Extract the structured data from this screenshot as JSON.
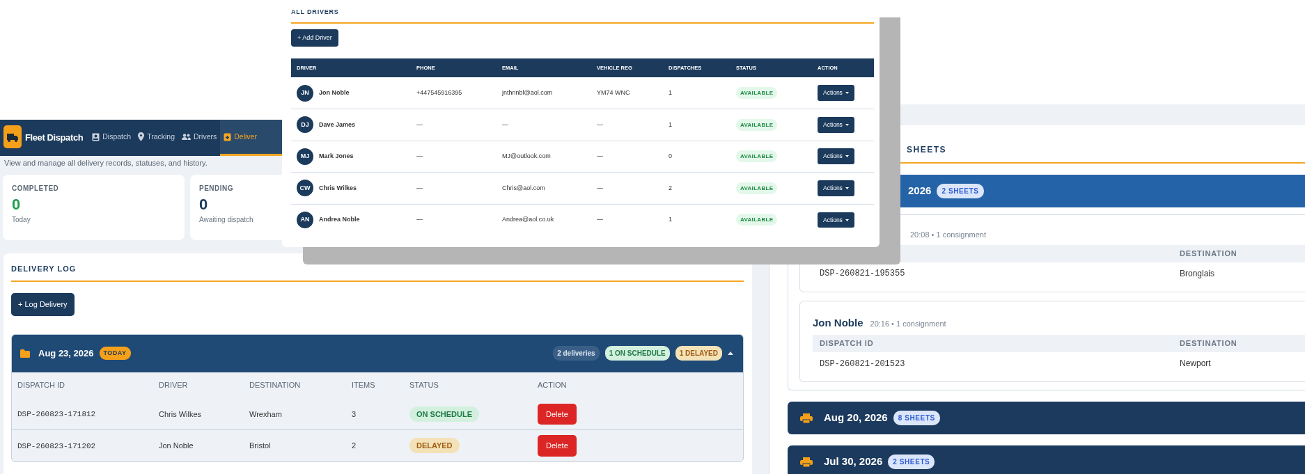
{
  "delivery_app": {
    "brand": "Fleet Dispatch",
    "nav": [
      {
        "label": "Dispatch",
        "selected": false
      },
      {
        "label": "Tracking",
        "selected": false
      },
      {
        "label": "Drivers",
        "selected": false
      },
      {
        "label": "Deliver",
        "selected": true
      }
    ],
    "subtitle": "View and manage all delivery records, statuses, and history.",
    "stats": [
      {
        "label": "COMPLETED",
        "value": "0",
        "caption": "Today",
        "color": "#1f9d4a"
      },
      {
        "label": "PENDING",
        "value": "0",
        "caption": "Awaiting dispatch",
        "color": "#1b3a5c"
      }
    ],
    "delivery_log": {
      "title": "DELIVERY LOG",
      "add_button": "+ Log Delivery",
      "groups": [
        {
          "date": "Aug 23, 2026",
          "date_badge": "TODAY",
          "expanded": true,
          "summary": [
            {
              "label": "2 deliveries",
              "kind": "count"
            },
            {
              "label": "1 ON SCHEDULE",
              "kind": "on_schedule"
            },
            {
              "label": "1 DELAYED",
              "kind": "delayed"
            }
          ],
          "columns": [
            "DISPATCH ID",
            "DRIVER",
            "DESTINATION",
            "ITEMS",
            "STATUS",
            "ACTION"
          ],
          "rows": [
            {
              "dispatch_id": "DSP-260823-171812",
              "driver": "Chris Wilkes",
              "destination": "Wrexham",
              "items": "3",
              "status": {
                "label": "ON SCHEDULE",
                "kind": "on_schedule"
              },
              "action": "Delete"
            },
            {
              "dispatch_id": "DSP-260823-171202",
              "driver": "Jon Noble",
              "destination": "Bristol",
              "items": "2",
              "status": {
                "label": "DELAYED",
                "kind": "delayed"
              },
              "action": "Delete"
            }
          ]
        }
      ]
    }
  },
  "drivers_panel": {
    "title": "ALL DRIVERS",
    "add_button": "+ Add Driver",
    "columns": [
      "DRIVER",
      "PHONE",
      "EMAIL",
      "VEHICLE REG",
      "DISPATCHES",
      "STATUS",
      "ACTION"
    ],
    "rows": [
      {
        "initials": "JN",
        "name": "Jon Noble",
        "phone": "+447545916395",
        "email": "jnthnnbl@aol.com",
        "vehicle_reg": "YM74 WNC",
        "dispatches": "1",
        "status": "AVAILABLE",
        "action": "Actions"
      },
      {
        "initials": "DJ",
        "name": "Dave James",
        "phone": "—",
        "email": "—",
        "vehicle_reg": "—",
        "dispatches": "1",
        "status": "AVAILABLE",
        "action": "Actions"
      },
      {
        "initials": "MJ",
        "name": "Mark Jones",
        "phone": "—",
        "email": "MJ@outlook.com",
        "vehicle_reg": "—",
        "dispatches": "0",
        "status": "AVAILABLE",
        "action": "Actions"
      },
      {
        "initials": "CW",
        "name": "Chris Wilkes",
        "phone": "—",
        "email": "Chris@aol.com",
        "vehicle_reg": "—",
        "dispatches": "2",
        "status": "AVAILABLE",
        "action": "Actions"
      },
      {
        "initials": "AN",
        "name": "Andrea Noble",
        "phone": "—",
        "email": "Andrea@aol.co.uk",
        "vehicle_reg": "—",
        "dispatches": "1",
        "status": "AVAILABLE",
        "action": "Actions"
      }
    ]
  },
  "sheets_panel": {
    "title": "SHEETS",
    "groups": [
      {
        "date": "2026",
        "badge": "2 SHEETS",
        "expanded": true,
        "sheets": [
          {
            "meta": "20:08 • 1 consignment",
            "columns": [
              "",
              "DESTINATION"
            ],
            "rows": [
              [
                "DSP-260821-195355",
                "Bronglais"
              ]
            ]
          },
          {
            "driver": "Jon Noble",
            "meta": "20:16 • 1 consignment",
            "columns": [
              "DISPATCH ID",
              "DESTINATION"
            ],
            "rows": [
              [
                "DSP-260821-201523",
                "Newport"
              ]
            ]
          }
        ]
      },
      {
        "date": "Aug 20, 2026",
        "badge": "8 SHEETS",
        "expanded": false
      },
      {
        "date": "Jul 30, 2026",
        "badge": "2 SHEETS",
        "expanded": false
      }
    ]
  }
}
